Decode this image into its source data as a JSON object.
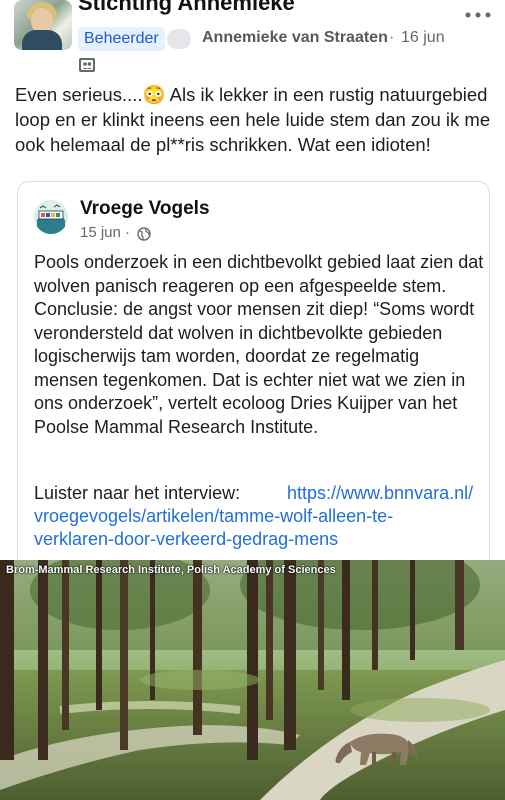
{
  "header": {
    "page_name": "Stichting Annemieke",
    "role_badge": "Beheerder",
    "author": "Annemieke van Straaten",
    "separator": "·",
    "date": "16 jun"
  },
  "post": {
    "text": "Even serieus....😳 Als ik lekker in een rustig natuurgebied loop en er klinkt ineens een hele luide stem dan zou ik me ook helemaal de pl**ris schrikken. Wat een idioten!"
  },
  "shared": {
    "page_name": "Vroege Vogels",
    "date": "15 jun",
    "separator": "·",
    "body": "Pools onderzoek in een dichtbevolkt gebied laat zien dat wolven panisch reageren op een afgespeelde stem. Conclusie: de angst voor mensen zit diep! “Soms wordt verondersteld dat wolven in dichtbevolkte gebieden logischerwijs tam worden, doordat ze regelmatig mensen tegenkomen. Dat is echter niet wat we zien in ons onderzoek”, vertelt ecoloog Dries Kuijper van het Poolse Mammal Research Institute.",
    "link_label": "Luister naar het interview: ",
    "link_part1": "https://www.bnnvara.nl/",
    "link_part2": "vroegevogels/artikelen/tamme-wolf-alleen-te-",
    "link_part3": "verklaren-door-verkeerd-gedrag-mens"
  },
  "photo": {
    "credit": "Brom-Mammal Research Institute, Polish Academy of Sciences"
  },
  "icons": {
    "more": "more-horizontal-icon",
    "audience": "group-audience-icon",
    "globe": "globe-icon"
  },
  "colors": {
    "link": "#216fdb",
    "badge_bg": "#e7f0fd",
    "badge_text": "#1a5dc9"
  }
}
